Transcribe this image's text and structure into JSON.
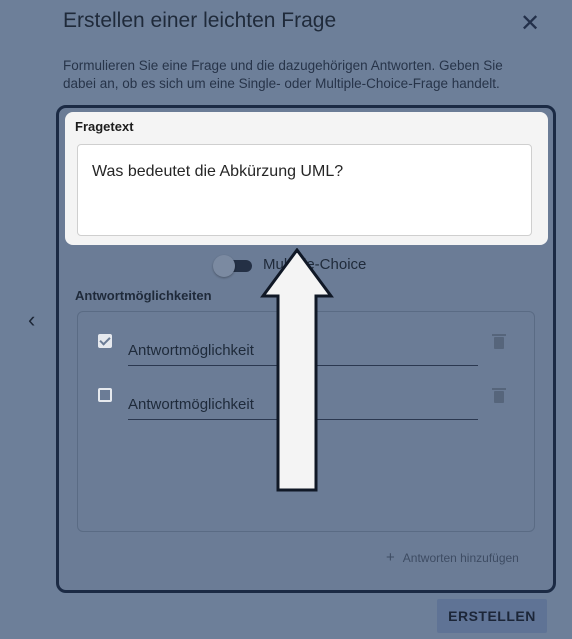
{
  "dialog": {
    "title": "Erstellen einer leichten Frage",
    "close_symbol": "✕",
    "description": "Formulieren Sie eine Frage und die dazugehörigen Antworten. Geben Sie dabei an, ob es sich um eine Single- oder Multiple-Choice-Frage handelt.",
    "back_symbol": "‹"
  },
  "question": {
    "label": "Fragetext",
    "value": "Was bedeutet die Abkürzung UML?"
  },
  "toggle": {
    "label": "Multiple-Choice",
    "on": false
  },
  "answers": {
    "label": "Antwortmöglichkeiten",
    "items": [
      {
        "placeholder": "Antwortmöglichkeit",
        "checked": true
      },
      {
        "placeholder": "Antwortmöglichkeit",
        "checked": false
      }
    ],
    "add_label": "Antworten hinzufügen",
    "add_symbol": "+"
  },
  "actions": {
    "create_label": "ERSTELLEN"
  },
  "icons": {
    "close": "close-icon",
    "back": "chevron-left-icon",
    "delete": "trash-icon",
    "annotation": "up-arrow-annotation"
  },
  "colors": {
    "overlay": "#6f819a",
    "border": "#1b2a44",
    "highlight": "#f4f4f4",
    "button": "#5f7395"
  }
}
